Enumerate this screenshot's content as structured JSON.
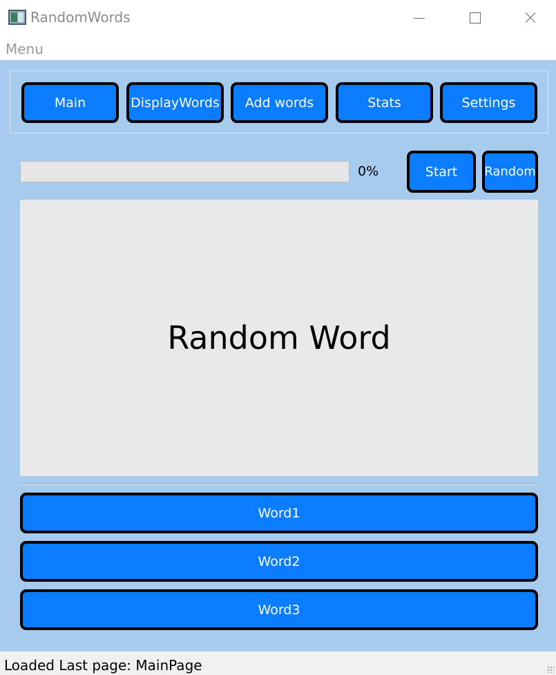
{
  "window": {
    "title": "RandomWords",
    "icon": "app-icon",
    "controls": [
      "minimize-icon",
      "maximize-icon",
      "close-icon"
    ]
  },
  "menubar": {
    "items": [
      {
        "label": "Menu"
      }
    ]
  },
  "nav": {
    "buttons": [
      {
        "label": "Main"
      },
      {
        "label": "DisplayWords"
      },
      {
        "label": "Add words"
      },
      {
        "label": "Stats"
      },
      {
        "label": "Settings"
      }
    ]
  },
  "progress": {
    "value": 0,
    "label": "0%"
  },
  "actions": {
    "start_label": "Start",
    "random_label": "Random"
  },
  "display": {
    "word": "Random Word"
  },
  "choices": [
    {
      "label": "Word1"
    },
    {
      "label": "Word2"
    },
    {
      "label": "Word3"
    }
  ],
  "status": {
    "text": "Loaded Last page: MainPage"
  },
  "colors": {
    "button_bg": "#0a7cff",
    "button_border": "#000000",
    "main_bg": "#a6cbee",
    "display_bg": "#e9e9e9",
    "progress_fill": "#06b025"
  }
}
